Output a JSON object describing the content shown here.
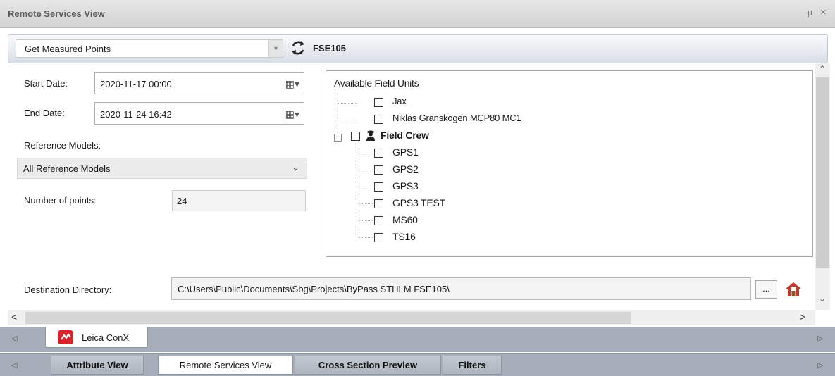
{
  "panel": {
    "title": "Remote Services View",
    "pin_glyph": "μ",
    "close_glyph": "×"
  },
  "toolbar": {
    "query_select_value": "Get Measured Points",
    "device_label": "FSE105",
    "icons": [
      "refresh-icon"
    ]
  },
  "form": {
    "start_date_label": "Start Date:",
    "start_date_value": "2020-11-17 00:00",
    "end_date_label": "End Date:",
    "end_date_value": "2020-11-24 16:42",
    "reference_models_label": "Reference Models:",
    "reference_models_value": "All Reference Models",
    "number_of_points_label": "Number of points:",
    "number_of_points_value": "24",
    "destination_label": "Destination Directory:",
    "destination_value": "C:\\Users\\Public\\Documents\\Sbg\\Projects\\ByPass STHLM FSE105\\",
    "browse_label": "..."
  },
  "tree": {
    "heading": "Available Field Units",
    "items": [
      {
        "label": "Jax",
        "checked": false
      },
      {
        "label": "Niklas Granskogen MCP80 MC1",
        "checked": false
      }
    ],
    "group": {
      "label": "Field Crew",
      "checked": false,
      "expanded": true,
      "children": [
        {
          "label": "GPS1",
          "checked": false
        },
        {
          "label": "GPS2",
          "checked": false
        },
        {
          "label": "GPS3",
          "checked": false
        },
        {
          "label": "GPS3 TEST",
          "checked": false
        },
        {
          "label": "MS60",
          "checked": false
        },
        {
          "label": "TS16",
          "checked": false
        }
      ]
    }
  },
  "tabs_upper": [
    {
      "label": "Leica ConX",
      "active": true
    }
  ],
  "tabs_lower": [
    {
      "label": "Attribute View",
      "active": false
    },
    {
      "label": "Remote Services View",
      "active": true
    },
    {
      "label": "Cross Section Preview",
      "active": false
    },
    {
      "label": "Filters",
      "active": false
    }
  ],
  "colors": {
    "accent_red": "#d8232a",
    "tab_strip": "#a6aeb9"
  }
}
